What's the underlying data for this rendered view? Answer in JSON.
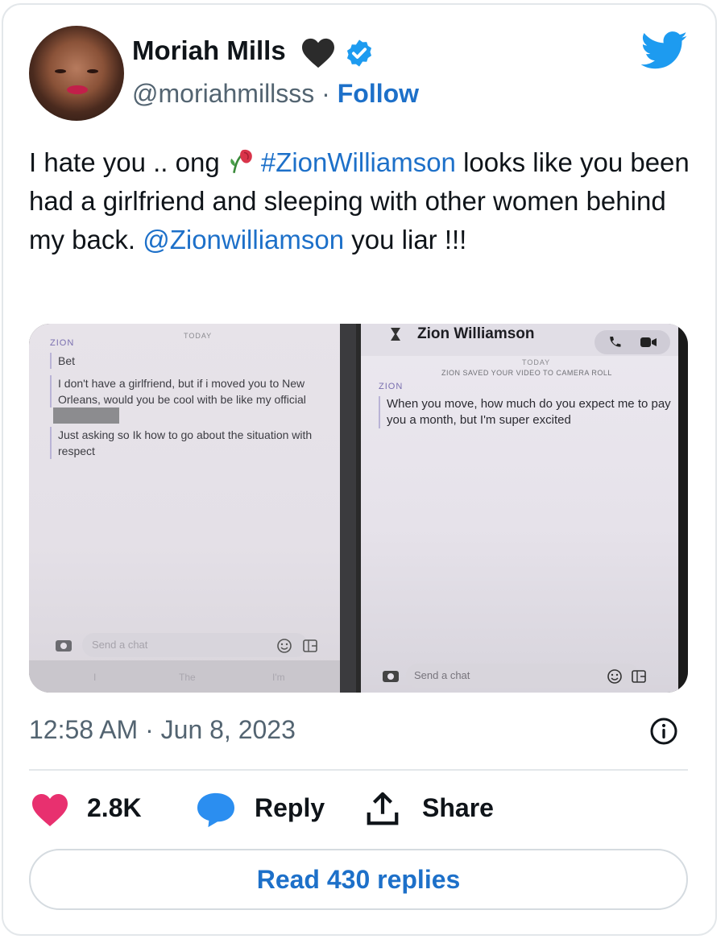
{
  "author": {
    "display_name": "Moriah Mills",
    "handle": "@moriahmillsss",
    "separator": "·",
    "follow_label": "Follow",
    "emoji_icon": "black-heart-icon",
    "verified_icon": "verified-badge-icon"
  },
  "platform_icon": "twitter-bird-icon",
  "tweet": {
    "text_1": "I hate you .. ong ",
    "emoji": "wilted-rose-icon",
    "hashtag": "#ZionWilliamson",
    "text_2": " looks like you been had a girlfriend and sleeping with other women behind my back. ",
    "mention": "@Zionwilliamson",
    "text_3": " you liar !!!"
  },
  "media": {
    "left": {
      "today": "TODAY",
      "sender": "ZION",
      "messages": [
        "Bet",
        "I don't have a girlfriend, but if i moved you to New Orleans, would you be cool with be like my official",
        "Just asking so Ik how to go about the situation with respect"
      ],
      "chat_placeholder": "Send a chat",
      "keyboard_suggestions": [
        "I",
        "The",
        "I'm"
      ]
    },
    "right": {
      "contact_name": "Zion Williamson",
      "today": "TODAY",
      "notice": "ZION SAVED YOUR VIDEO TO CAMERA ROLL",
      "sender": "ZION",
      "message": "When you move, how much do you expect me to pay you a month, but I'm super excited",
      "chat_placeholder": "Send a chat"
    }
  },
  "timestamp": "12:58 AM · Jun 8, 2023",
  "actions": {
    "likes": "2.8K",
    "reply_label": "Reply",
    "share_label": "Share"
  },
  "read_replies_label": "Read 430 replies",
  "colors": {
    "link": "#1d70c9",
    "like": "#e8306f",
    "reply": "#2b8ef0",
    "muted": "#536471"
  }
}
